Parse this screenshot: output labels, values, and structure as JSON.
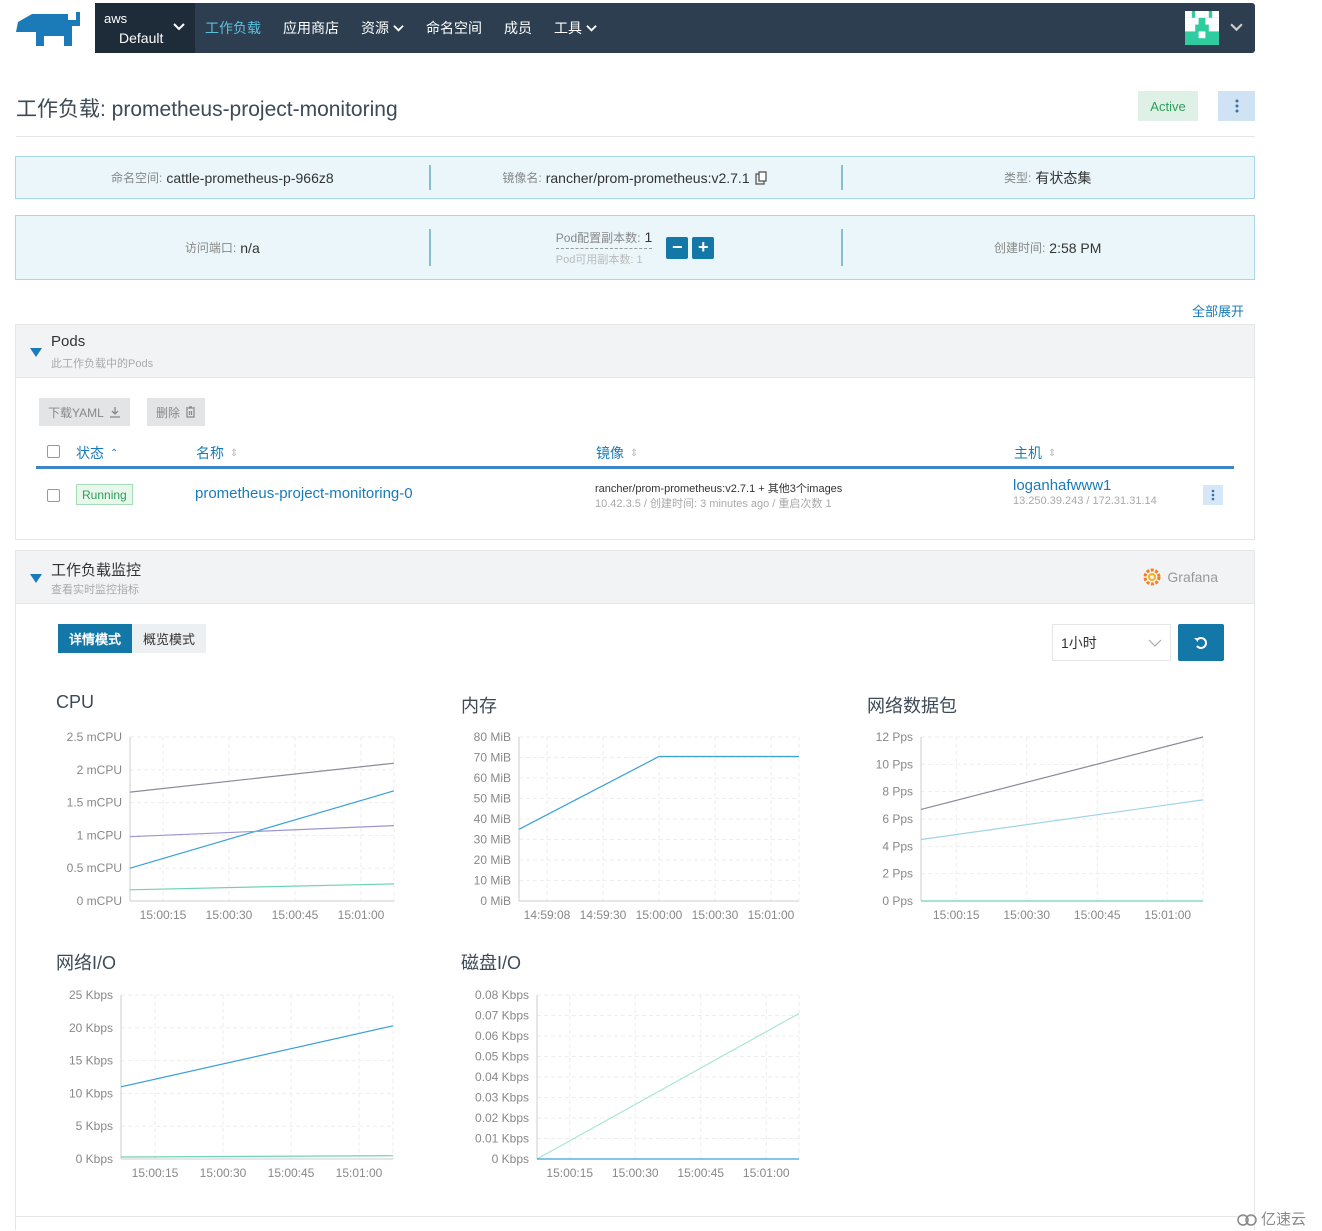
{
  "nav": {
    "cluster_label": "aws",
    "project_label": "Default",
    "items": [
      {
        "label": "工作负载",
        "active": true,
        "dropdown": false
      },
      {
        "label": "应用商店",
        "active": false,
        "dropdown": false
      },
      {
        "label": "资源",
        "active": false,
        "dropdown": true
      },
      {
        "label": "命名空间",
        "active": false,
        "dropdown": false
      },
      {
        "label": "成员",
        "active": false,
        "dropdown": false
      },
      {
        "label": "工具",
        "active": false,
        "dropdown": true
      }
    ]
  },
  "header": {
    "title": "工作负载: prometheus-project-monitoring",
    "status": "Active"
  },
  "info1": {
    "namespace_label": "命名空间:",
    "namespace_value": "cattle-prometheus-p-966z8",
    "image_label": "镜像名:",
    "image_value": "rancher/prom-prometheus:v2.7.1",
    "type_label": "类型:",
    "type_value": "有状态集"
  },
  "info2": {
    "port_label": "访问端口:",
    "port_value": "n/a",
    "replicas_config_label": "Pod配置副本数:",
    "replicas_config_value": "1",
    "replicas_available_label": "Pod可用副本数:",
    "replicas_available_value": "1",
    "created_label": "创建时间:",
    "created_value": "2:58 PM"
  },
  "expand_all": "全部展开",
  "pods": {
    "title": "Pods",
    "subtitle": "此工作负载中的Pods",
    "download_yaml": "下载YAML",
    "delete": "删除",
    "columns": {
      "state": "状态",
      "name": "名称",
      "image": "镜像",
      "host": "主机"
    },
    "rows": [
      {
        "state": "Running",
        "name": "prometheus-project-monitoring-0",
        "image": "rancher/prom-prometheus:v2.7.1 + 其他3个images",
        "image_sub": "10.42.3.5 / 创建时间: 3 minutes ago / 重启次数 1",
        "host": "loganhafwww1",
        "host_sub": "13.250.39.243  /  172.31.31.14"
      }
    ]
  },
  "monitoring": {
    "title": "工作负载监控",
    "subtitle": "查看实时监控指标",
    "grafana": "Grafana",
    "mode_detail": "详情模式",
    "mode_overview": "概览模式",
    "range": "1小时"
  },
  "chart_data": [
    {
      "type": "line",
      "title": "CPU",
      "unit": "mCPU",
      "yticks": [
        "0 mCPU",
        "0.5 mCPU",
        "1 mCPU",
        "1.5 mCPU",
        "2 mCPU",
        "2.5 mCPU"
      ],
      "ylim": [
        0,
        2.5
      ],
      "xticks": [
        "15:00:15",
        "15:00:30",
        "15:00:45",
        "15:01:00"
      ],
      "x": [
        0,
        1
      ],
      "series": [
        {
          "name": "s1",
          "color": "#8a8a9a",
          "values": [
            1.66,
            2.1
          ]
        },
        {
          "name": "s2",
          "color": "#3aa0d8",
          "values": [
            0.5,
            1.68
          ]
        },
        {
          "name": "s3",
          "color": "#9d95d4",
          "values": [
            0.98,
            1.15
          ]
        },
        {
          "name": "s4",
          "color": "#6fd2b6",
          "values": [
            0.17,
            0.26
          ]
        }
      ]
    },
    {
      "type": "line",
      "title": "内存",
      "unit": "MiB",
      "yticks": [
        "0 MiB",
        "10 MiB",
        "20 MiB",
        "30 MiB",
        "40 MiB",
        "50 MiB",
        "60 MiB",
        "70 MiB",
        "80 MiB"
      ],
      "ylim": [
        0,
        80
      ],
      "xticks": [
        "14:59:08",
        "14:59:30",
        "15:00:00",
        "15:00:30",
        "15:01:00"
      ],
      "x": [
        0,
        0.5,
        1
      ],
      "series": [
        {
          "name": "s1",
          "color": "#3aa0d8",
          "values": [
            35,
            70.5,
            70.5
          ]
        }
      ]
    },
    {
      "type": "line",
      "title": "网络数据包",
      "unit": "Pps",
      "yticks": [
        "0 Pps",
        "2 Pps",
        "4 Pps",
        "6 Pps",
        "8 Pps",
        "10 Pps",
        "12 Pps"
      ],
      "ylim": [
        0,
        12
      ],
      "xticks": [
        "15:00:15",
        "15:00:30",
        "15:00:45",
        "15:01:00"
      ],
      "x": [
        0,
        1
      ],
      "series": [
        {
          "name": "s1",
          "color": "#8a8a9a",
          "values": [
            6.7,
            12
          ]
        },
        {
          "name": "s2",
          "color": "#9fd3e8",
          "values": [
            4.5,
            7.4
          ]
        },
        {
          "name": "s3",
          "color": "#6fd2b6",
          "values": [
            0,
            0
          ]
        }
      ]
    },
    {
      "type": "line",
      "title": "网络I/O",
      "unit": "Kbps",
      "yticks": [
        "0 Kbps",
        "5 Kbps",
        "10 Kbps",
        "15 Kbps",
        "20 Kbps",
        "25 Kbps"
      ],
      "ylim": [
        0,
        25
      ],
      "xticks": [
        "15:00:15",
        "15:00:30",
        "15:00:45",
        "15:01:00"
      ],
      "x": [
        0,
        1
      ],
      "series": [
        {
          "name": "s1",
          "color": "#3aa0d8",
          "values": [
            11,
            20.3
          ]
        },
        {
          "name": "s2",
          "color": "#6fd2b6",
          "values": [
            0.3,
            0.5
          ]
        }
      ]
    },
    {
      "type": "line",
      "title": "磁盘I/O",
      "unit": "Kbps",
      "yticks": [
        "0 Kbps",
        "0.01 Kbps",
        "0.02 Kbps",
        "0.03 Kbps",
        "0.04 Kbps",
        "0.05 Kbps",
        "0.06 Kbps",
        "0.07 Kbps",
        "0.08 Kbps"
      ],
      "ylim": [
        0,
        0.08
      ],
      "xticks": [
        "15:00:15",
        "15:00:30",
        "15:00:45",
        "15:01:00"
      ],
      "x": [
        0,
        1
      ],
      "series": [
        {
          "name": "s1",
          "color": "#a8e6d3",
          "values": [
            0,
            0.071
          ]
        },
        {
          "name": "s2",
          "color": "#3aa0d8",
          "values": [
            0,
            0
          ]
        }
      ]
    }
  ],
  "watermark": "亿速云"
}
